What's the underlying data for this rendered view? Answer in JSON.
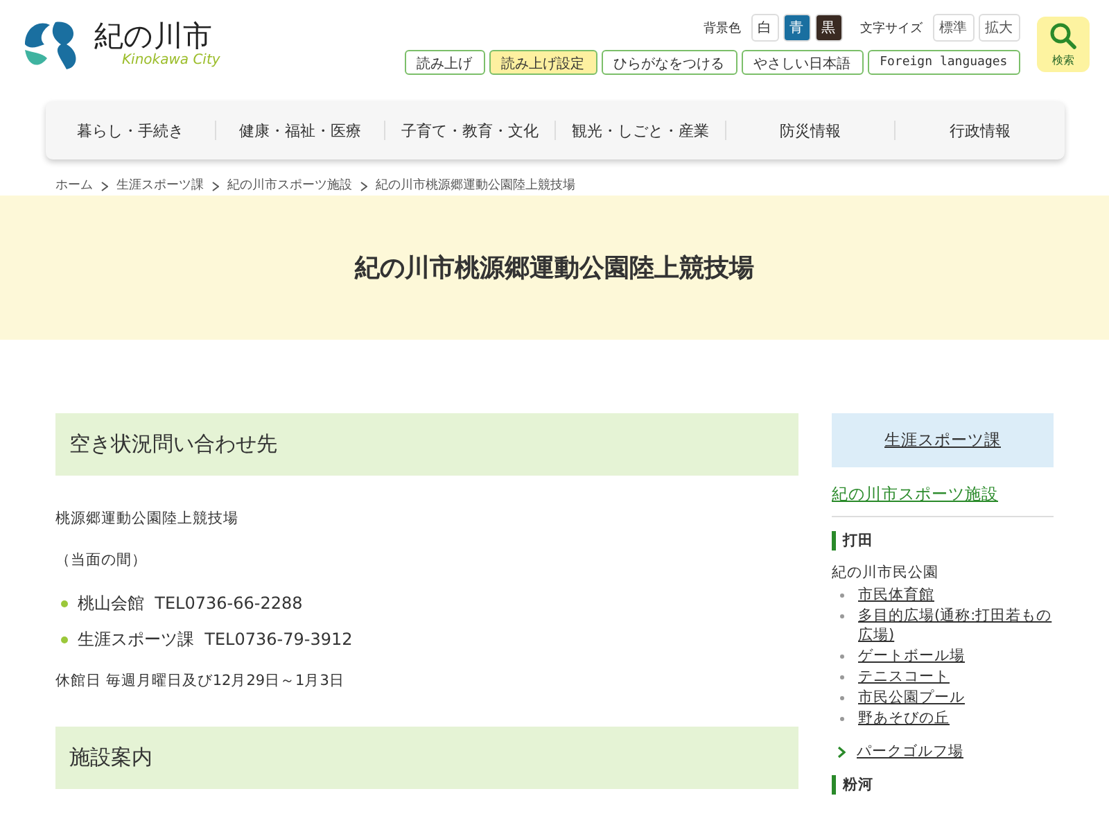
{
  "logo": {
    "name": "紀の川市",
    "tagline": "Kinokawa City"
  },
  "background_color": {
    "label": "背景色",
    "options": [
      {
        "label": "白",
        "color": "#ffffff"
      },
      {
        "label": "青",
        "color": "#1a6fa0"
      },
      {
        "label": "黒",
        "color": "#3a2a22"
      }
    ]
  },
  "font_size": {
    "label": "文字サイズ",
    "options": [
      "標準",
      "拡大"
    ]
  },
  "tools": [
    {
      "label": "読み上げ",
      "highlighted": false
    },
    {
      "label": "読み上げ設定",
      "highlighted": true
    },
    {
      "label": "ひらがなをつける",
      "highlighted": false
    },
    {
      "label": "やさしい日本語",
      "highlighted": false
    },
    {
      "label": "Foreign languages",
      "highlighted": false
    }
  ],
  "search_button": {
    "label": "検索"
  },
  "nav": [
    "暮らし・手続き",
    "健康・福祉・医療",
    "子育て・教育・文化",
    "観光・しごと・産業",
    "防災情報",
    "行政情報"
  ],
  "breadcrumb": [
    "ホーム",
    "生涯スポーツ課",
    "紀の川市スポーツ施設",
    "紀の川市桃源郷運動公園陸上競技場"
  ],
  "page_title": "紀の川市桃源郷運動公園陸上競技場",
  "sections": [
    {
      "heading": "空き状況問い合わせ先",
      "blocks": [
        {
          "kind": "paragraph",
          "text": "桃源郷運動公園陸上競技場"
        },
        {
          "kind": "paragraph",
          "text": "（当面の間）"
        },
        {
          "kind": "bullets",
          "items": [
            "桃山会館  TEL0736-66-2288",
            "生涯スポーツ課  TEL0736-79-3912"
          ]
        },
        {
          "kind": "paragraph",
          "text": "休館日 毎週月曜日及び12月29日～1月3日"
        }
      ]
    },
    {
      "heading": "施設案内"
    }
  ],
  "sidebar": {
    "department": "生涯スポーツ課",
    "category": "紀の川市スポーツ施設",
    "groups": [
      {
        "heading": "打田",
        "items": [
          {
            "label": "紀の川市民公園",
            "kind": "text",
            "children": [
              {
                "label": "市民体育館"
              },
              {
                "label": "多目的広場(通称:打田若もの広場)"
              },
              {
                "label": "ゲートボール場"
              },
              {
                "label": "テニスコート"
              },
              {
                "label": "市民公園プール"
              },
              {
                "label": "野あそびの丘"
              }
            ]
          },
          {
            "label": "パークゴルフ場",
            "kind": "link"
          }
        ]
      },
      {
        "heading": "粉河"
      }
    ]
  }
}
